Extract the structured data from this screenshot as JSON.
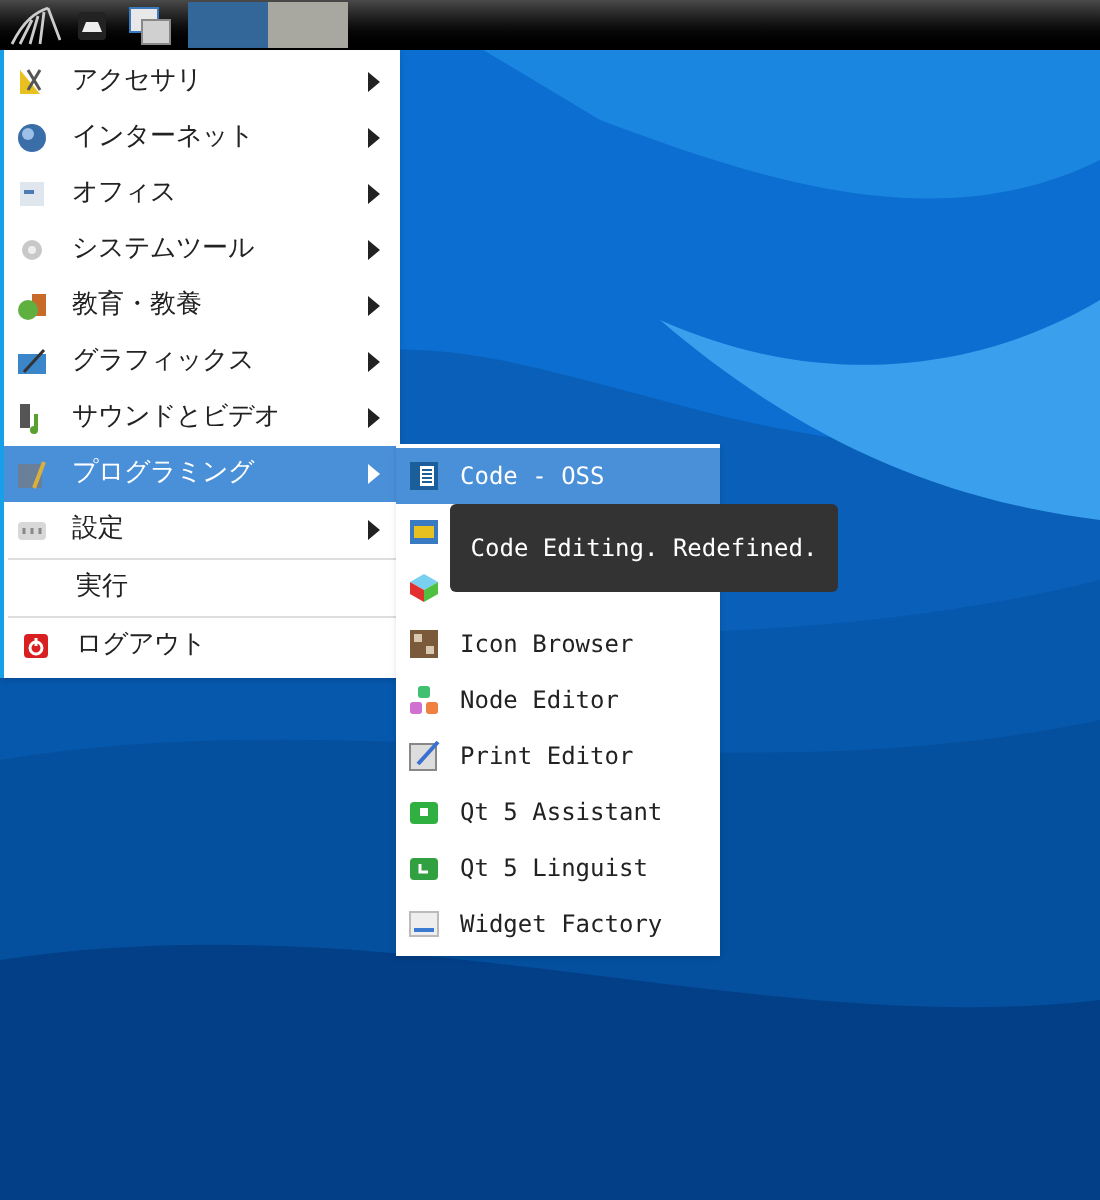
{
  "taskbar": {
    "tasks": [
      {
        "selected": true
      },
      {
        "selected": false
      }
    ]
  },
  "menu": {
    "sections": [
      [
        {
          "label": "アクセサリ",
          "submenu": true,
          "selected": false
        },
        {
          "label": "インターネット",
          "submenu": true,
          "selected": false
        },
        {
          "label": "オフィス",
          "submenu": true,
          "selected": false
        },
        {
          "label": "システムツール",
          "submenu": true,
          "selected": false
        },
        {
          "label": "教育・教養",
          "submenu": true,
          "selected": false
        },
        {
          "label": "グラフィックス",
          "submenu": true,
          "selected": false
        },
        {
          "label": "サウンドとビデオ",
          "submenu": true,
          "selected": false
        },
        {
          "label": "プログラミング",
          "submenu": true,
          "selected": true
        },
        {
          "label": "設定",
          "submenu": true,
          "selected": false
        }
      ],
      [
        {
          "label": "実行",
          "submenu": false,
          "selected": false
        }
      ],
      [
        {
          "label": "ログアウト",
          "submenu": false,
          "selected": false
        }
      ]
    ]
  },
  "submenu": {
    "items": [
      {
        "label": "Code - OSS",
        "selected": true
      },
      {
        "selected": false
      },
      {
        "selected": false
      },
      {
        "label": "Icon Browser",
        "selected": false
      },
      {
        "label": "Node Editor",
        "selected": false
      },
      {
        "label": "Print Editor",
        "selected": false
      },
      {
        "label": "Qt 5 Assistant",
        "selected": false
      },
      {
        "label": "Qt 5 Linguist",
        "selected": false
      },
      {
        "label": "Widget Factory",
        "selected": false
      }
    ]
  },
  "tooltip": {
    "text": "Code Editing. Redefined."
  }
}
